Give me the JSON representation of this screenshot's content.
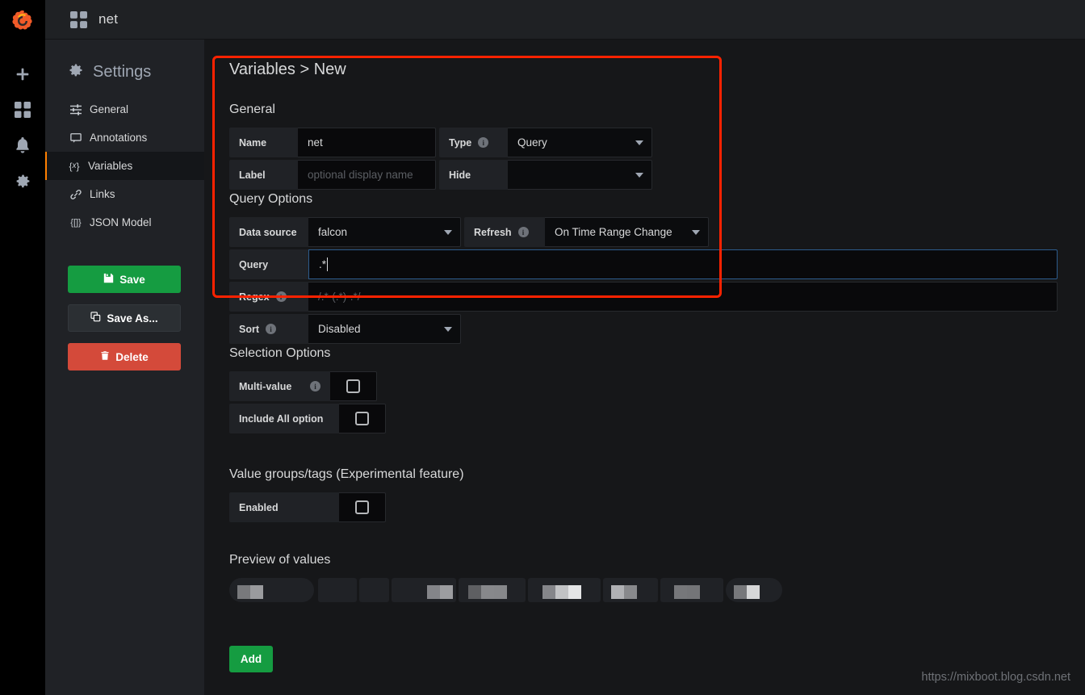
{
  "rail": {
    "logo_icon": "grafana-logo-icon",
    "items": [
      {
        "icon": "plus-icon",
        "name": "create"
      },
      {
        "icon": "dashboards-grid-icon",
        "name": "dashboards"
      },
      {
        "icon": "bell-icon",
        "name": "alerting"
      },
      {
        "icon": "gear-icon",
        "name": "configuration"
      }
    ]
  },
  "topbar": {
    "dashboard_icon": "dashboards-grid-icon",
    "title": "net"
  },
  "sidebar": {
    "heading": "Settings",
    "heading_icon": "gear-icon",
    "items": [
      {
        "label": "General",
        "icon": "sliders-icon",
        "active": false
      },
      {
        "label": "Annotations",
        "icon": "comment-icon",
        "active": false
      },
      {
        "label": "Variables",
        "icon": "braces-x-icon",
        "active": true
      },
      {
        "label": "Links",
        "icon": "link-icon",
        "active": false
      },
      {
        "label": "JSON Model",
        "icon": "braces-brackets-icon",
        "active": false
      }
    ],
    "buttons": {
      "save": {
        "label": "Save",
        "icon": "floppy-disk-icon",
        "color": "#159c41"
      },
      "save_as": {
        "label": "Save As...",
        "icon": "copy-icon",
        "color": "#2b2f33"
      },
      "delete": {
        "label": "Delete",
        "icon": "trash-icon",
        "color": "#d44a3a"
      }
    }
  },
  "main": {
    "title": "Variables > New",
    "sections": {
      "general": {
        "heading": "General",
        "name": {
          "label": "Name",
          "value": "net"
        },
        "type": {
          "label": "Type",
          "value": "Query",
          "info": true
        },
        "label_field": {
          "label": "Label",
          "value": "",
          "placeholder": "optional display name"
        },
        "hide": {
          "label": "Hide",
          "value": ""
        }
      },
      "query_options": {
        "heading": "Query Options",
        "data_source": {
          "label": "Data source",
          "value": "falcon"
        },
        "refresh": {
          "label": "Refresh",
          "value": "On Time Range Change",
          "info": true
        },
        "query": {
          "label": "Query",
          "value": ".*",
          "focused": true
        },
        "regex": {
          "label": "Regex",
          "value": "",
          "placeholder": "/.*-(.*)-.*/",
          "info": true
        },
        "sort": {
          "label": "Sort",
          "value": "Disabled",
          "info": true
        }
      },
      "selection_options": {
        "heading": "Selection Options",
        "multi_value": {
          "label": "Multi-value",
          "checked": false,
          "info": true
        },
        "include_all": {
          "label": "Include All option",
          "checked": false
        }
      },
      "value_groups": {
        "heading": "Value groups/tags (Experimental feature)",
        "enabled": {
          "label": "Enabled",
          "checked": false
        }
      },
      "preview": {
        "heading": "Preview of values",
        "values_redacted": true,
        "count": 9
      }
    },
    "add_button": {
      "label": "Add",
      "color": "#159c41"
    }
  },
  "annotation": {
    "color": "#ff2200",
    "shape": "rectangle"
  },
  "watermark": "https://mixboot.blog.csdn.net"
}
